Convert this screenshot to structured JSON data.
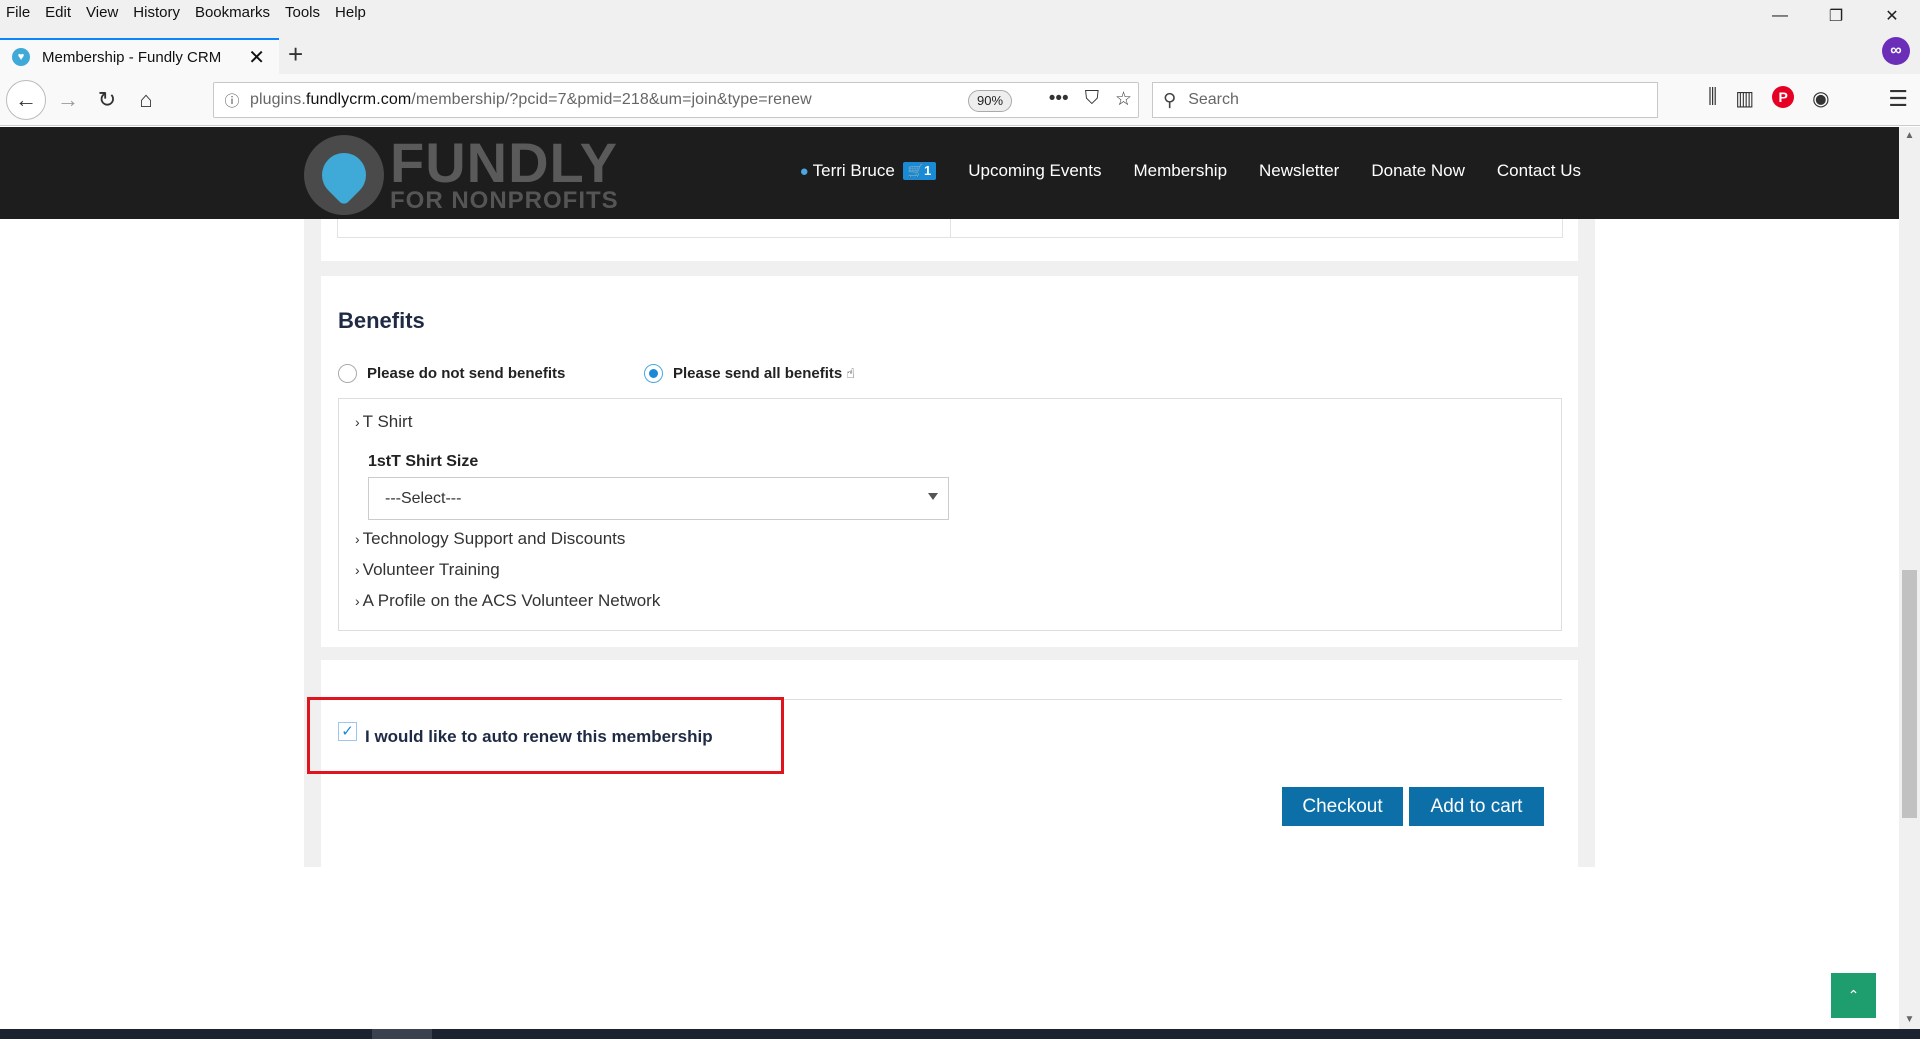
{
  "menubar": {
    "items": [
      "File",
      "Edit",
      "View",
      "History",
      "Bookmarks",
      "Tools",
      "Help"
    ]
  },
  "window": {
    "minimize": "—",
    "restore": "❐",
    "close": "✕"
  },
  "tab": {
    "title": "Membership - Fundly CRM",
    "close": "✕",
    "new_tab": "+"
  },
  "nav": {
    "url_prefix": "plugins.",
    "url_domain": "fundlycrm.com",
    "url_path": "/membership/?pcid=7&pmid=218&um=join&type=renew",
    "zoom": "90%",
    "search_placeholder": "Search"
  },
  "site": {
    "logo_title": "FUNDLY",
    "logo_sub": "FOR NONPROFITS",
    "user_name": "Terri Bruce",
    "cart_count": "1",
    "nav_items": [
      "Upcoming Events",
      "Membership",
      "Newsletter",
      "Donate Now",
      "Contact Us"
    ]
  },
  "benefits": {
    "title": "Benefits",
    "option_none": "Please do not send benefits",
    "option_all": "Please send all benefits",
    "selected": "Please send all benefits",
    "items": [
      "T Shirt",
      "Technology Support and Discounts",
      "Volunteer Training",
      "A Profile on the ACS Volunteer Network"
    ],
    "shirt_label": "1stT Shirt Size",
    "shirt_select_value": "---Select---"
  },
  "renew": {
    "label": "I would like to auto renew this membership",
    "checked": true
  },
  "buttons": {
    "checkout": "Checkout",
    "add_to_cart": "Add to cart"
  },
  "colors": {
    "accent": "#0d6fa8",
    "highlight": "#e0141e",
    "header_bg": "#1d1d1d",
    "scroll_top": "#1e9e6e"
  }
}
